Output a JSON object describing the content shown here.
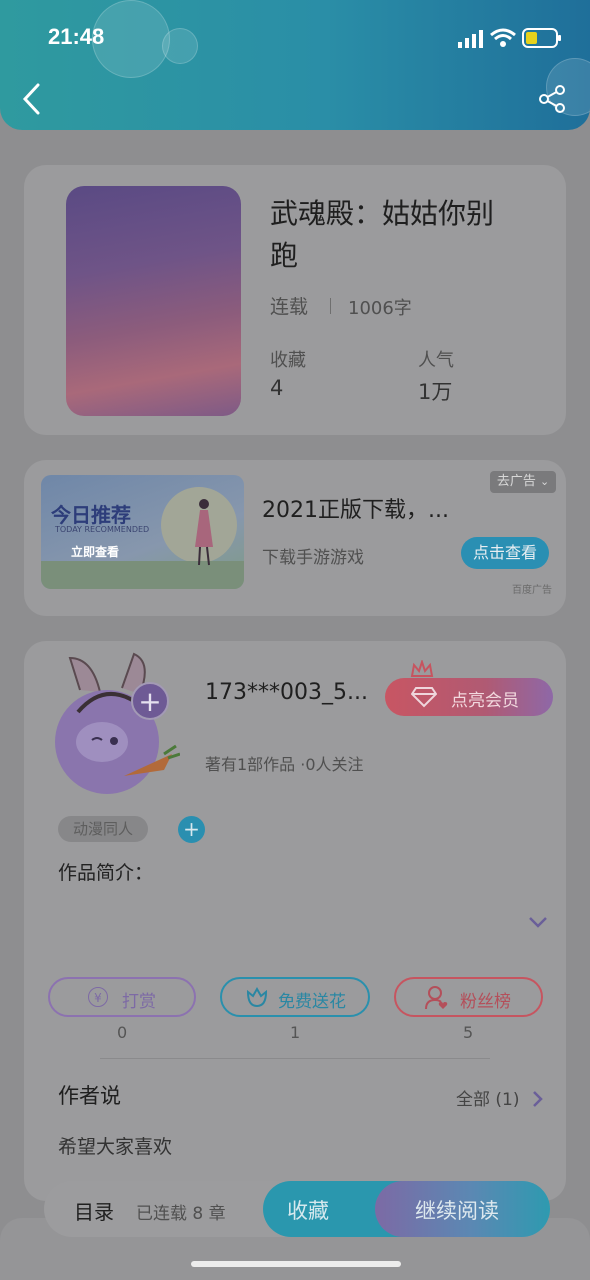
{
  "status": {
    "time": "21:48"
  },
  "book": {
    "title_line1": "武魂殿：姑姑你别",
    "title_line2": "跑",
    "status": "连载",
    "word_count": "1006字",
    "favorites_label": "收藏",
    "favorites_value": "4",
    "popularity_label": "人气",
    "popularity_value": "1万"
  },
  "ad": {
    "banner_title": "今日推荐",
    "banner_subtitle": "TODAY RECOMMENDED",
    "banner_action": "立即查看",
    "title": "2021正版下载，...",
    "desc": "下载手游游戏",
    "cta": "点击查看",
    "close_label": "去广告",
    "source": "百度广告"
  },
  "author": {
    "name": "173***003_5...",
    "vip_label": "点亮会员",
    "stats": "著有1部作品 ·0人关注",
    "tag": "动漫同人",
    "intro_label": "作品简介："
  },
  "actions": [
    {
      "label": "打赏",
      "count": "0",
      "icon_glyph": "¥"
    },
    {
      "label": "免费送花",
      "count": "1"
    },
    {
      "label": "粉丝榜",
      "count": "5"
    }
  ],
  "author_says": {
    "title": "作者说",
    "all_label": "全部 (1)",
    "content": "希望大家喜欢"
  },
  "bottom_bar": {
    "toc_label": "目录",
    "chapters": "已连载 8 章",
    "collect": "收藏",
    "read": "继续阅读"
  },
  "colors": {
    "accent_teal": "#2a9bb0",
    "vip_red": "#d9646f",
    "purple": "#8a6fb3"
  }
}
